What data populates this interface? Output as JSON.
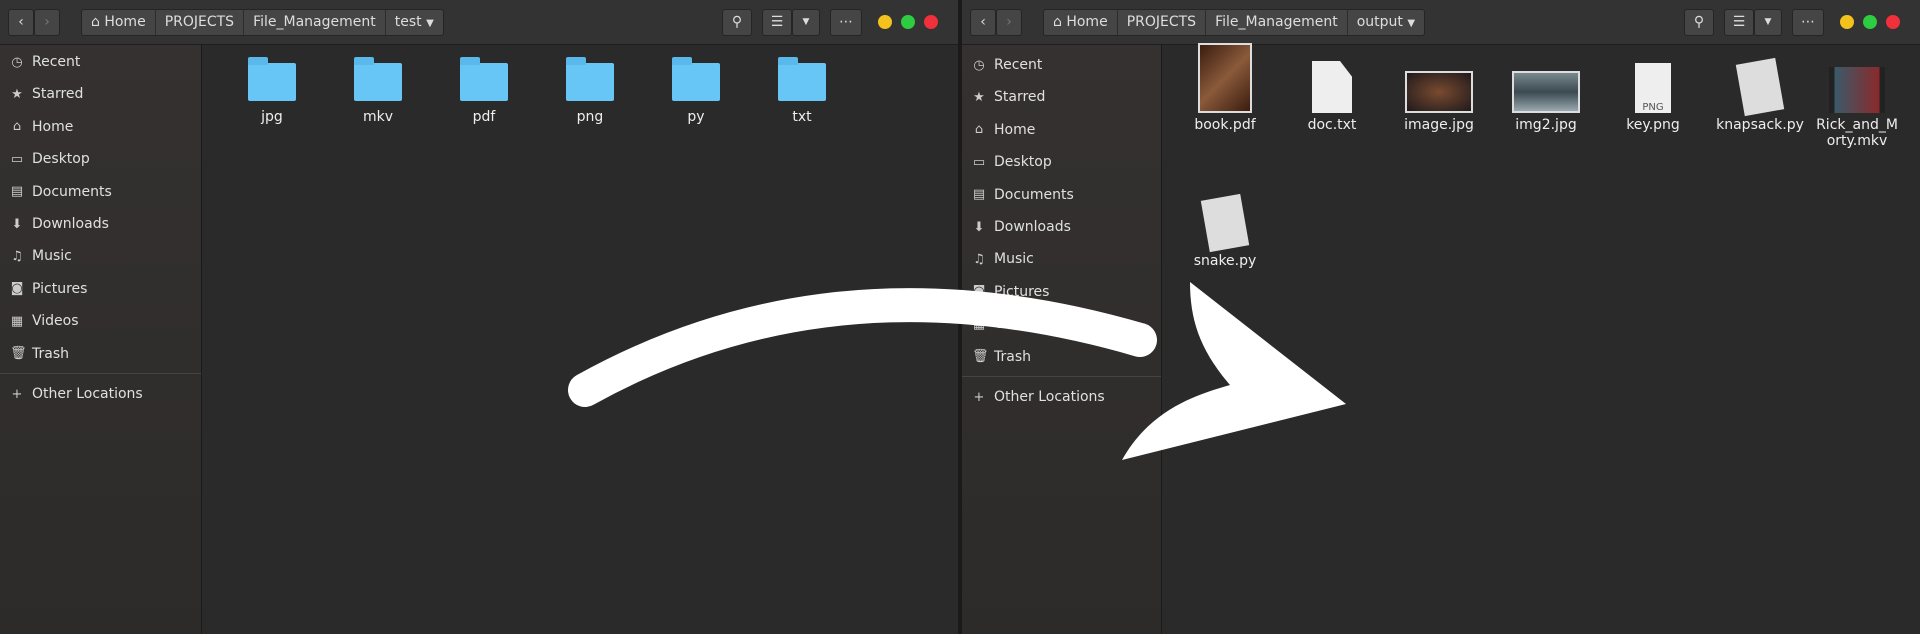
{
  "left_window": {
    "breadcrumbs": [
      "Home",
      "PROJECTS",
      "File_Management",
      "test"
    ],
    "sidebar": [
      "Recent",
      "Starred",
      "Home",
      "Desktop",
      "Documents",
      "Downloads",
      "Music",
      "Pictures",
      "Videos",
      "Trash"
    ],
    "other_locations": "Other Locations",
    "folders": [
      "jpg",
      "mkv",
      "pdf",
      "png",
      "py",
      "txt"
    ]
  },
  "right_window": {
    "breadcrumbs": [
      "Home",
      "PROJECTS",
      "File_Management",
      "output"
    ],
    "sidebar": [
      "Recent",
      "Starred",
      "Home",
      "Desktop",
      "Documents",
      "Downloads",
      "Music",
      "Pictures",
      "Videos",
      "Trash"
    ],
    "other_locations": "Other Locations",
    "files": [
      "book.pdf",
      "doc.txt",
      "image.jpg",
      "img2.jpg",
      "key.png",
      "knapsack.py",
      "Rick_and_Morty.mkv",
      "snake.py"
    ],
    "png_badge": "PNG"
  },
  "icons": {
    "sidebar": [
      "clock-icon",
      "star-icon",
      "home-icon",
      "desktop-icon",
      "documents-icon",
      "download-icon",
      "music-icon",
      "camera-icon",
      "video-icon",
      "trash-icon"
    ]
  },
  "colors": {
    "folder": "#68c6f6",
    "minimize": "#f5c11c",
    "maximize": "#2ecc40",
    "close": "#f0303a",
    "arrow": "#ffffff"
  }
}
